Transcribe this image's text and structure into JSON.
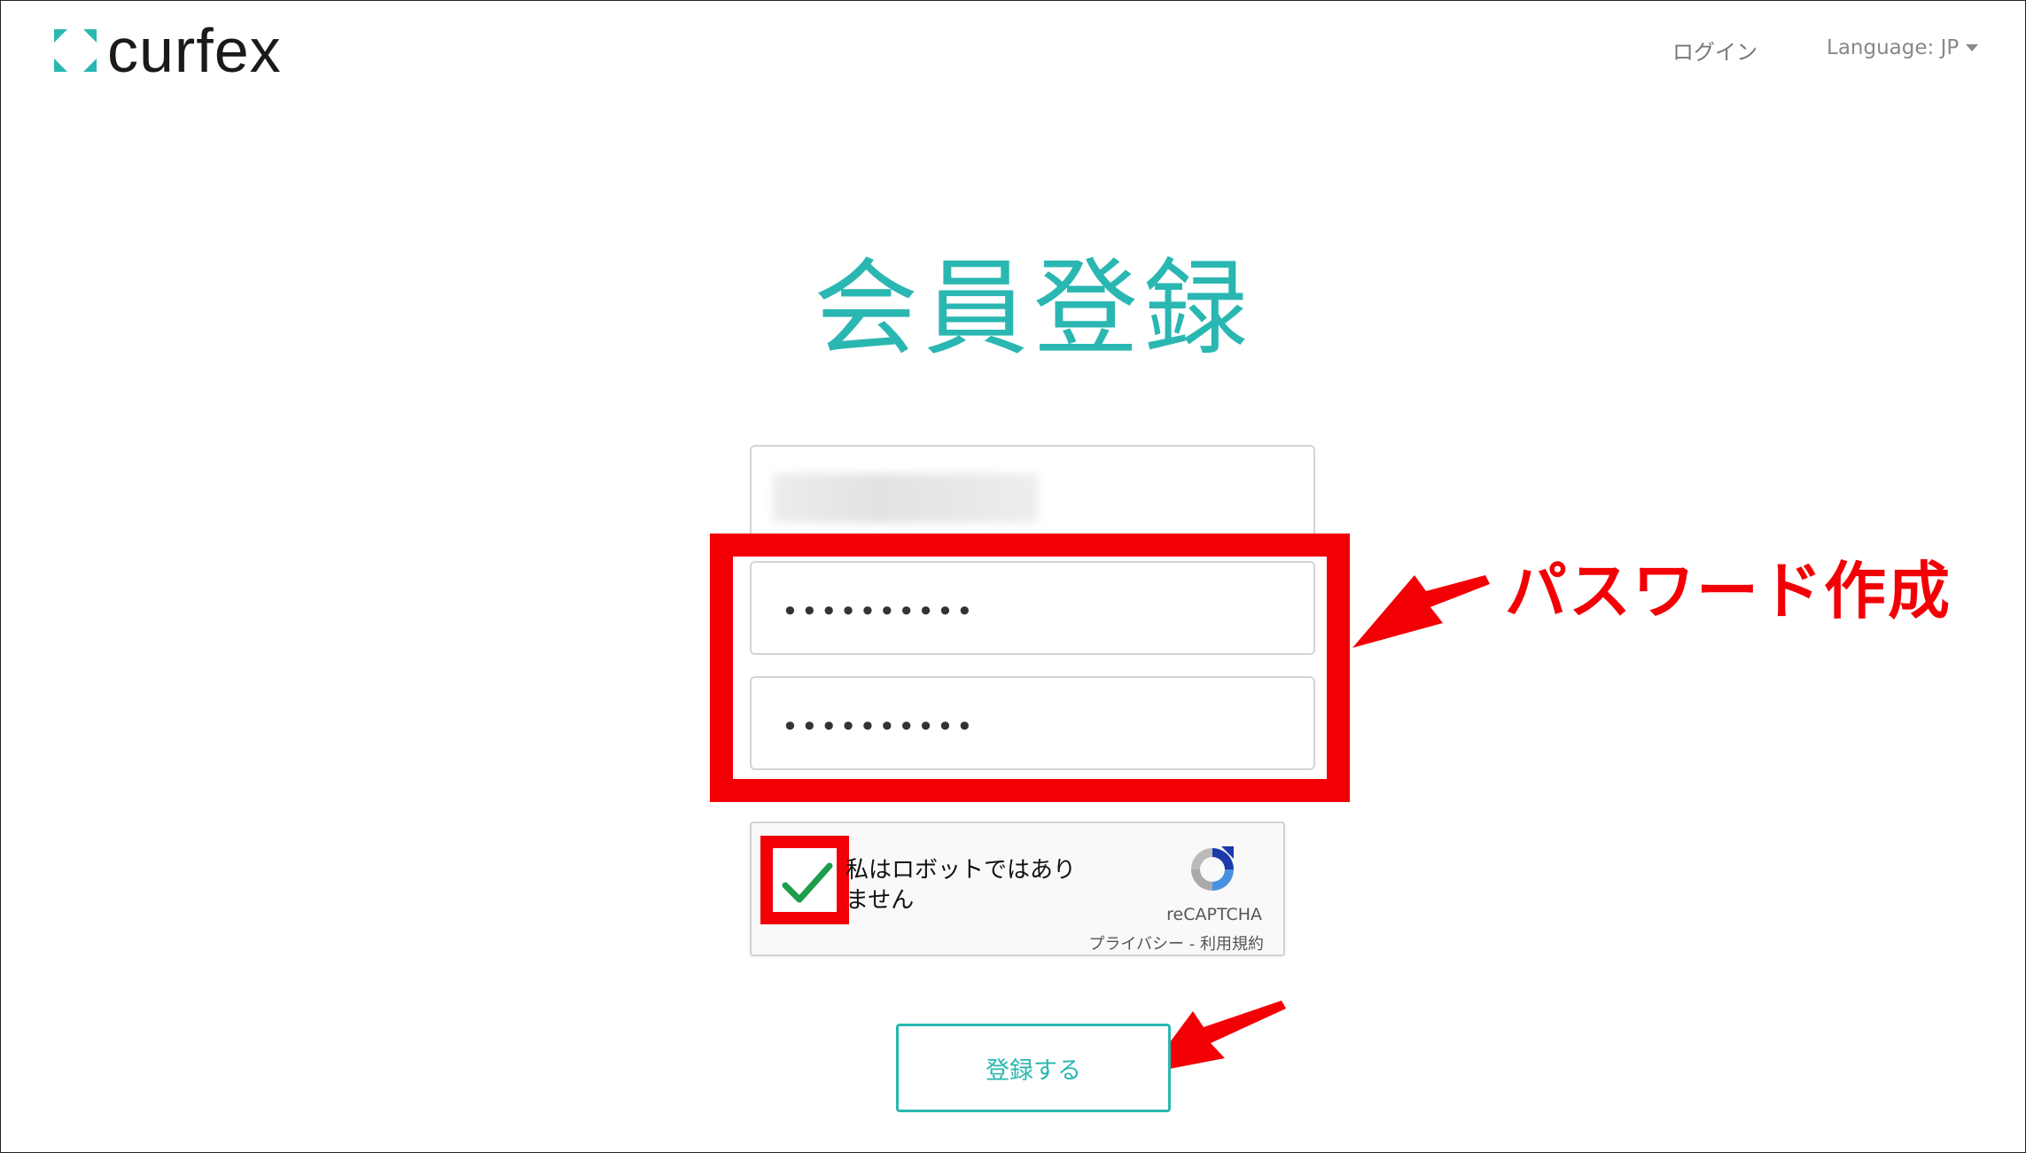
{
  "header": {
    "logo_text": "curfex",
    "login_link": "ログイン",
    "language_selector": "Language: JP"
  },
  "main": {
    "title": "会員登録",
    "password_field_1": {
      "masked_value": "••••••••••"
    },
    "password_field_2": {
      "masked_value": "••••••••••"
    },
    "recaptcha": {
      "label_line1": "私はロボットではあり",
      "label_line2": "ません",
      "checked": true,
      "brand": "reCAPTCHA",
      "links": "プライバシー - 利用規約"
    },
    "submit_label": "登録する"
  },
  "annotations": {
    "password_note": "パスワード作成",
    "highlight_color": "#f20006"
  },
  "colors": {
    "accent": "#2ab7b2",
    "annotation_red": "#f20006"
  }
}
